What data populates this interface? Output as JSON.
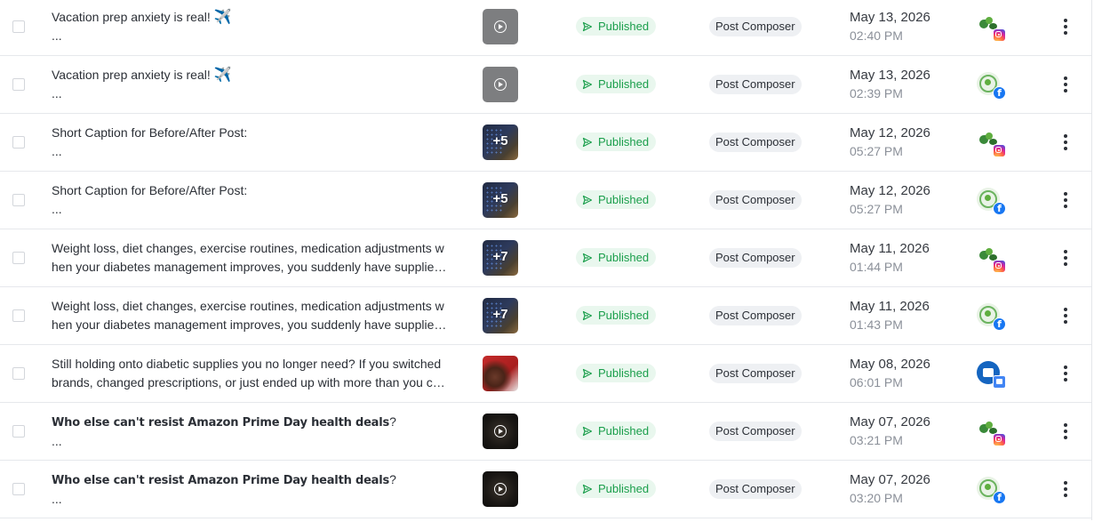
{
  "colors": {
    "status_text": "#1a9e4b",
    "status_bg": "#e9f7ee",
    "source_bg": "#eef0f3",
    "row_divider": "#e6e8ec",
    "instagram": "#d6249f",
    "facebook": "#1877f2"
  },
  "rows": [
    {
      "caption_line1": "Vacation prep anxiety is real!",
      "caption_emoji": "✈️",
      "caption_line2": "...",
      "bold": false,
      "media": {
        "kind": "video",
        "style": "video-gray",
        "count": ""
      },
      "status": "Published",
      "source": "Post Composer",
      "date": "May 13, 2026",
      "time": "02:40 PM",
      "network": "instagram",
      "avatar": "leaf-logo"
    },
    {
      "caption_line1": "Vacation prep anxiety is real!",
      "caption_emoji": "✈️",
      "caption_line2": "...",
      "bold": false,
      "media": {
        "kind": "video",
        "style": "video-gray",
        "count": ""
      },
      "status": "Published",
      "source": "Post Composer",
      "date": "May 13, 2026",
      "time": "02:39 PM",
      "network": "facebook",
      "avatar": "ring-logo"
    },
    {
      "caption_line1": "Short Caption for Before/After Post:",
      "caption_emoji": "",
      "caption_line2": "...",
      "bold": false,
      "media": {
        "kind": "gallery",
        "style": "dark-navy",
        "count": "+5"
      },
      "status": "Published",
      "source": "Post Composer",
      "date": "May 12, 2026",
      "time": "05:27 PM",
      "network": "instagram",
      "avatar": "leaf-logo"
    },
    {
      "caption_line1": "Short Caption for Before/After Post:",
      "caption_emoji": "",
      "caption_line2": "...",
      "bold": false,
      "media": {
        "kind": "gallery",
        "style": "dark-navy",
        "count": "+5"
      },
      "status": "Published",
      "source": "Post Composer",
      "date": "May 12, 2026",
      "time": "05:27 PM",
      "network": "facebook",
      "avatar": "ring-logo"
    },
    {
      "caption_line1": "Weight loss, diet changes, exercise routines, medication adjustments w",
      "caption_emoji": "",
      "caption_line2": "hen your diabetes management improves, you suddenly have supplie…",
      "bold": false,
      "media": {
        "kind": "gallery",
        "style": "dark-navy",
        "count": "+7"
      },
      "status": "Published",
      "source": "Post Composer",
      "date": "May 11, 2026",
      "time": "01:44 PM",
      "network": "instagram",
      "avatar": "leaf-logo"
    },
    {
      "caption_line1": "Weight loss, diet changes, exercise routines, medication adjustments w",
      "caption_emoji": "",
      "caption_line2": "hen your diabetes management improves, you suddenly have supplie…",
      "bold": false,
      "media": {
        "kind": "gallery",
        "style": "dark-navy",
        "count": "+7"
      },
      "status": "Published",
      "source": "Post Composer",
      "date": "May 11, 2026",
      "time": "01:43 PM",
      "network": "facebook",
      "avatar": "ring-logo"
    },
    {
      "caption_line1": "Still holding onto diabetic supplies you no longer need? If you switched",
      "caption_emoji": "",
      "caption_line2": "brands, changed prescriptions, or just ended up with more than you c…",
      "bold": false,
      "media": {
        "kind": "image",
        "style": "red-food",
        "count": ""
      },
      "status": "Published",
      "source": "Post Composer",
      "date": "May 08, 2026",
      "time": "06:01 PM",
      "network": "gbp",
      "avatar": "store-logo"
    },
    {
      "caption_line1": "Who else can't resist Amazon Prime Day health deals",
      "caption_line1_suffix": "?",
      "caption_emoji": "",
      "caption_line2": "...",
      "bold": true,
      "media": {
        "kind": "video",
        "style": "black-video",
        "count": ""
      },
      "status": "Published",
      "source": "Post Composer",
      "date": "May 07, 2026",
      "time": "03:21 PM",
      "network": "instagram",
      "avatar": "leaf-logo"
    },
    {
      "caption_line1": "Who else can't resist Amazon Prime Day health deals",
      "caption_line1_suffix": "?",
      "caption_emoji": "",
      "caption_line2": "...",
      "bold": true,
      "media": {
        "kind": "video",
        "style": "black-video",
        "count": ""
      },
      "status": "Published",
      "source": "Post Composer",
      "date": "May 07, 2026",
      "time": "03:20 PM",
      "network": "facebook",
      "avatar": "ring-logo"
    }
  ]
}
